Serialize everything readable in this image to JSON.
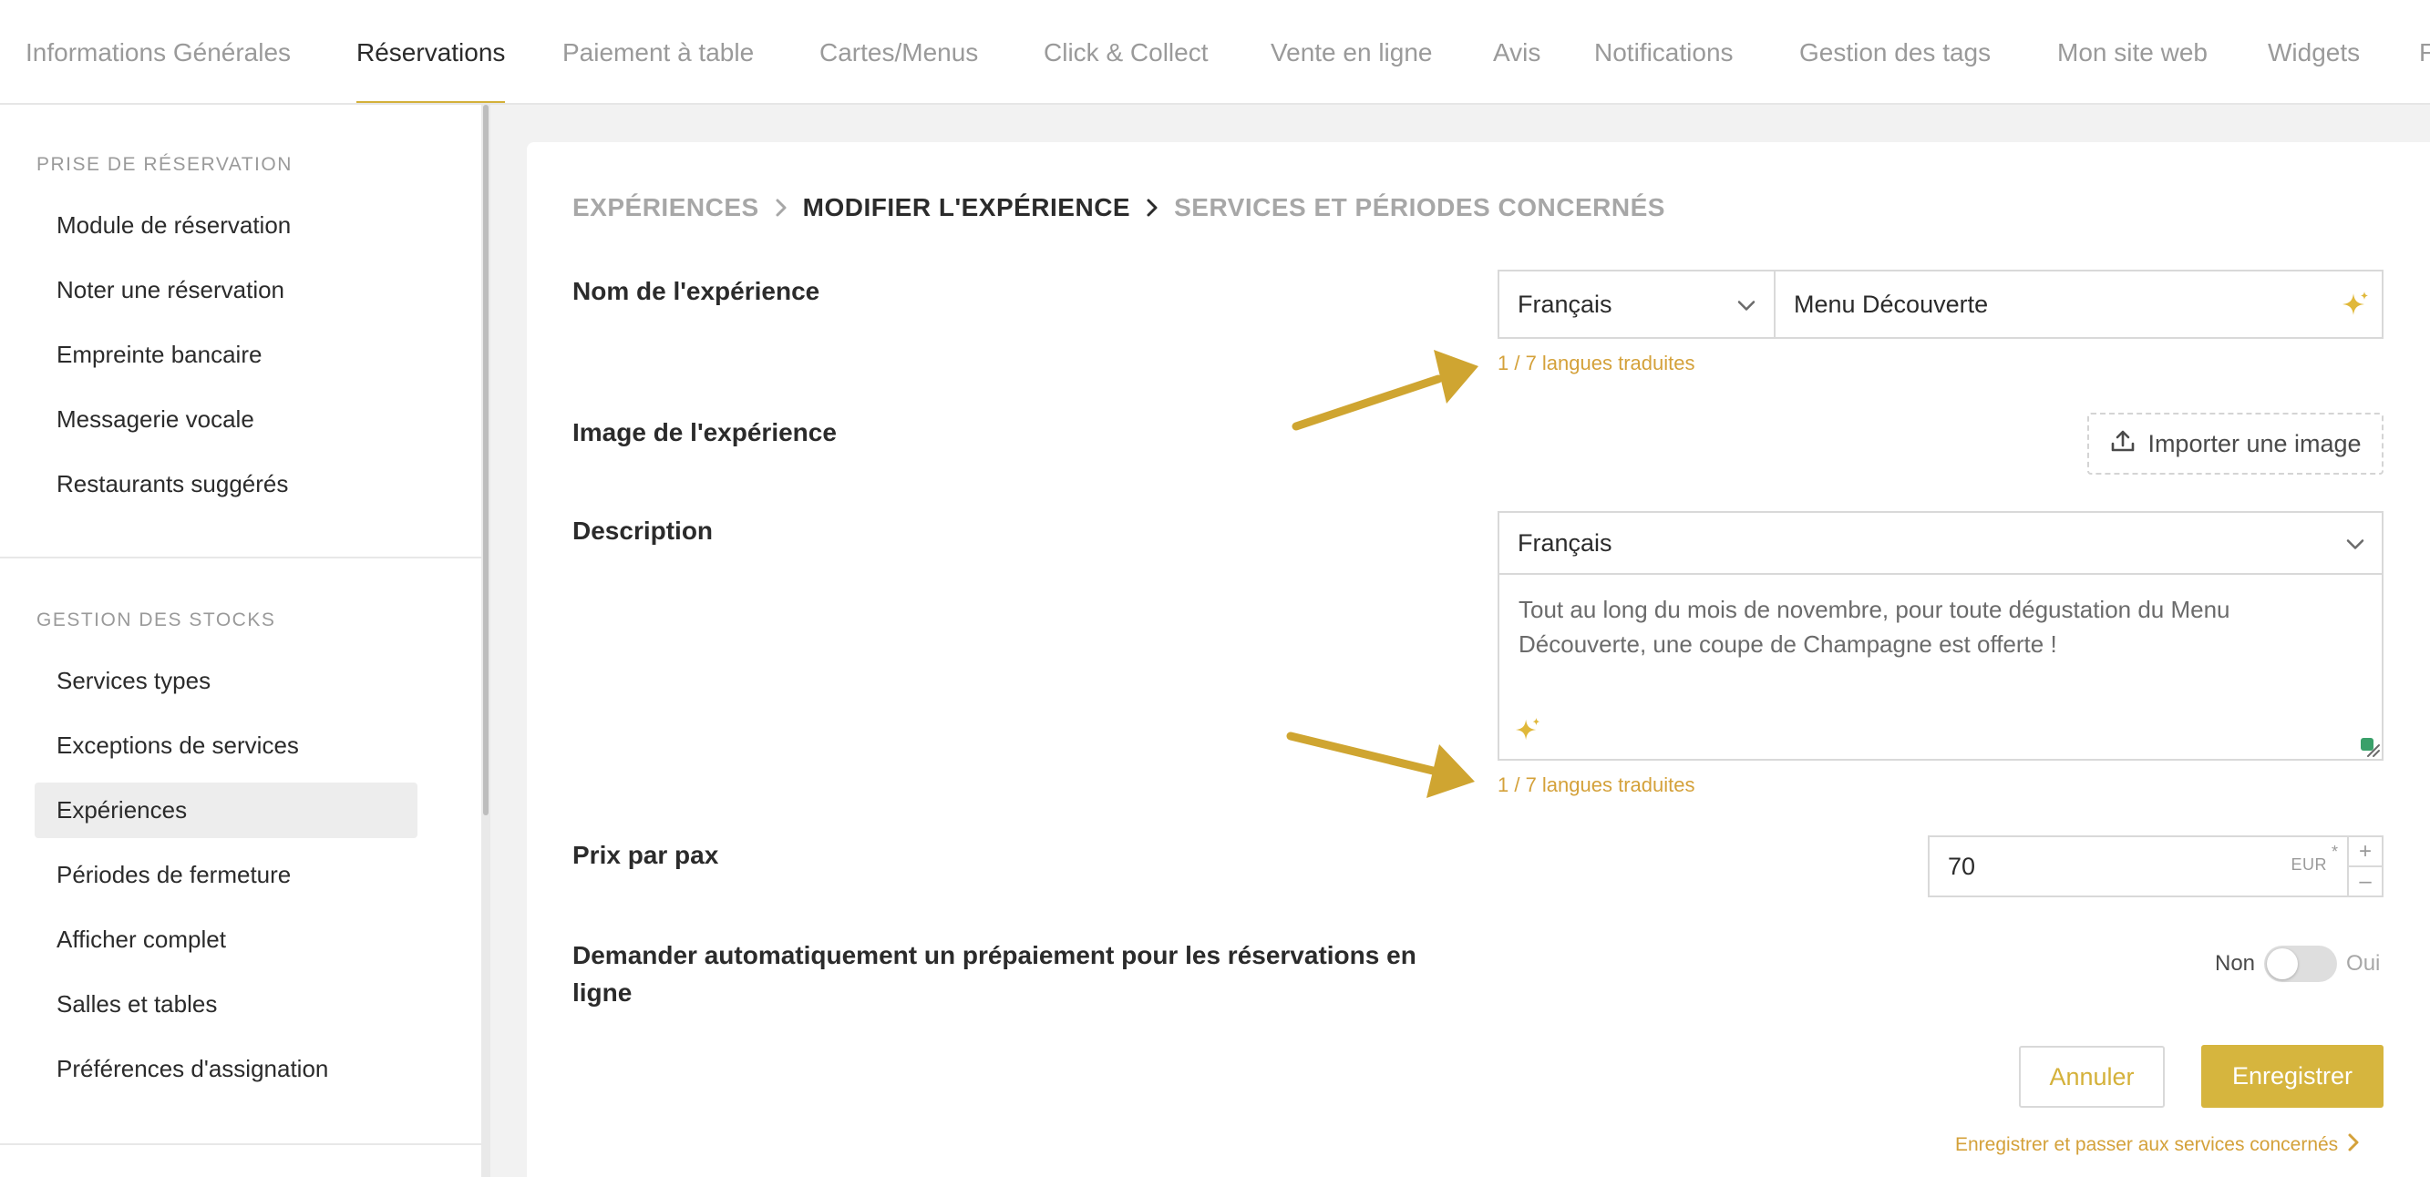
{
  "colors": {
    "accent": "#d4b13a",
    "translated_text": "#d4a13a",
    "annotation_arrow": "#cfa531",
    "sparkle": "#e0b83a",
    "resize_handle": "#3aa06a"
  },
  "tabs": [
    {
      "label": "Informations Générales",
      "active": false
    },
    {
      "label": "Réservations",
      "active": true
    },
    {
      "label": "Paiement à table",
      "active": false
    },
    {
      "label": "Cartes/Menus",
      "active": false
    },
    {
      "label": "Click & Collect",
      "active": false
    },
    {
      "label": "Vente en ligne",
      "active": false
    },
    {
      "label": "Avis",
      "active": false
    },
    {
      "label": "Notifications",
      "active": false
    },
    {
      "label": "Gestion des tags",
      "active": false
    },
    {
      "label": "Mon site web",
      "active": false
    },
    {
      "label": "Widgets",
      "active": false
    },
    {
      "label": "F",
      "active": false
    }
  ],
  "sidebar": {
    "section1_title": "PRISE DE RÉSERVATION",
    "section1_items": [
      "Module de réservation",
      "Noter une réservation",
      "Empreinte bancaire",
      "Messagerie vocale",
      "Restaurants suggérés"
    ],
    "section2_title": "GESTION DES STOCKS",
    "section2_items": [
      "Services types",
      "Exceptions de services",
      "Expériences",
      "Périodes de fermeture",
      "Afficher complet",
      "Salles et tables",
      "Préférences d'assignation"
    ],
    "active_item": "Expériences"
  },
  "breadcrumb": [
    {
      "label": "EXPÉRIENCES",
      "current": false
    },
    {
      "label": "MODIFIER L'EXPÉRIENCE",
      "current": true
    },
    {
      "label": "SERVICES ET PÉRIODES CONCERNÉS",
      "current": false
    }
  ],
  "form": {
    "name_label": "Nom de l'expérience",
    "name_language": "Français",
    "name_value": "Menu Découverte",
    "name_translated": "1 / 7 langues traduites",
    "image_label": "Image de l'expérience",
    "image_button": "Importer une image",
    "description_label": "Description",
    "description_language": "Français",
    "description_value": "Tout au long du mois de novembre, pour toute dégustation du Menu Découverte, une coupe de Champagne est offerte !",
    "description_translated": "1 / 7 langues traduites",
    "price_label": "Prix par pax",
    "price_value": "70",
    "price_unit": "EUR",
    "price_required_mark": "*",
    "price_plus": "+",
    "price_minus": "–",
    "prepay_label": "Demander automatiquement un prépaiement pour les réservations en ligne",
    "toggle_off_label": "Non",
    "toggle_on_label": "Oui",
    "toggle_value": false
  },
  "actions": {
    "cancel": "Annuler",
    "save": "Enregistrer",
    "save_next": "Enregistrer et passer aux services concernés"
  },
  "icons": {
    "sparkle": "sparkle-icon",
    "chevron": "chevron-down-icon",
    "upload": "upload-icon",
    "breadcrumb_sep": "chevron-right-icon"
  }
}
